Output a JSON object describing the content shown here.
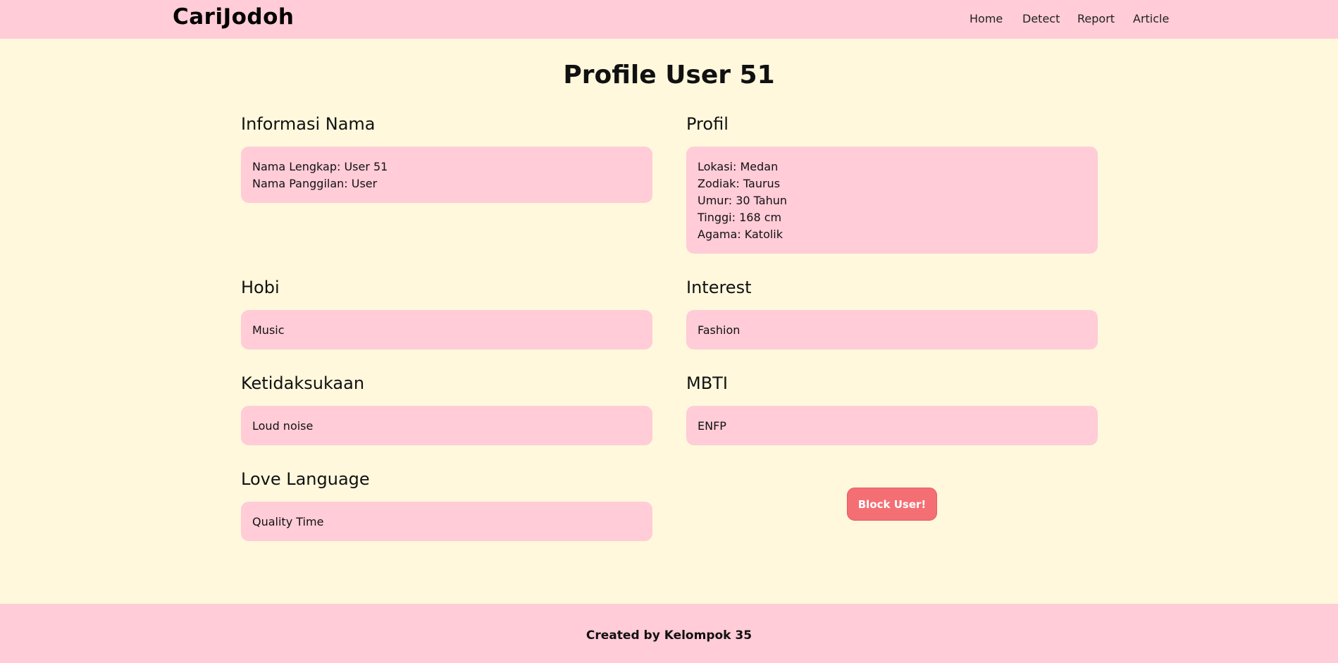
{
  "navbar": {
    "brand": "CariJodoh",
    "links": [
      "Home",
      "Detect",
      "Report",
      "Article"
    ]
  },
  "page_title": "Profile User 51",
  "sections": {
    "nama": {
      "title": "Informasi Nama",
      "lines": [
        "Nama Lengkap: User 51",
        "Nama Panggilan: User"
      ]
    },
    "profil": {
      "title": "Profil",
      "lines": [
        "Lokasi: Medan",
        "Zodiak: Taurus",
        "Umur: 30 Tahun",
        "Tinggi: 168 cm",
        "Agama: Katolik"
      ]
    },
    "hobi": {
      "title": "Hobi",
      "value": "Music"
    },
    "interest": {
      "title": "Interest",
      "value": "Fashion"
    },
    "ketidaksukaan": {
      "title": "Ketidaksukaan",
      "value": "Loud noise"
    },
    "mbti": {
      "title": "MBTI",
      "value": "ENFP"
    },
    "love_language": {
      "title": "Love Language",
      "value": "Quality Time"
    }
  },
  "block_button": "Block User!",
  "footer": "Created by Kelompok 35",
  "colors": {
    "background": "#fff8dc",
    "navbar": "#ffccd8",
    "card": "#ffccd8",
    "block_button": "#f46f74"
  }
}
